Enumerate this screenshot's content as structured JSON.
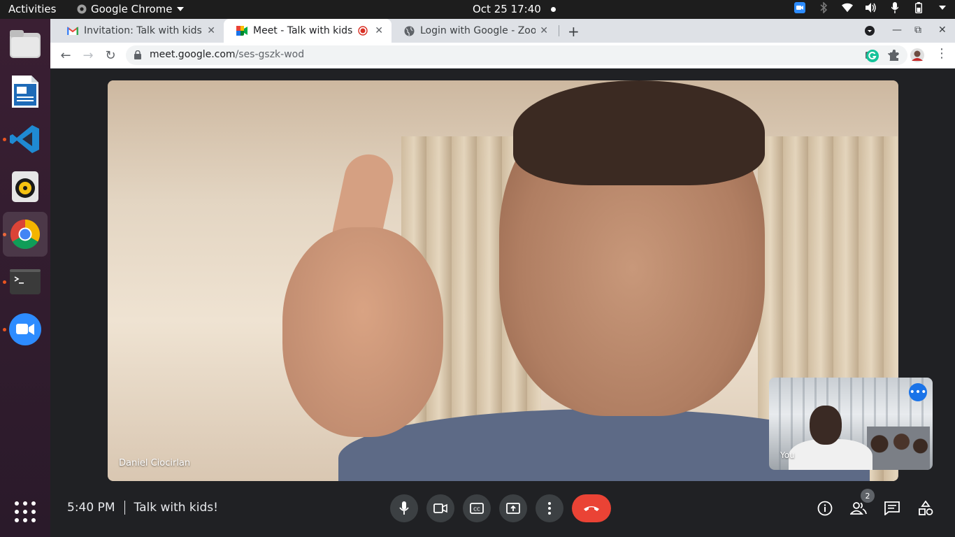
{
  "topbar": {
    "activities": "Activities",
    "app_name": "Google Chrome",
    "datetime": "Oct 25  17:40"
  },
  "dock": {
    "items": [
      "files",
      "libreoffice-writer",
      "vscode",
      "rhythmbox",
      "google-chrome",
      "terminal",
      "zoom"
    ],
    "show_apps": "show-applications"
  },
  "browser": {
    "tabs": [
      {
        "title": "Invitation: Talk with kids!",
        "icon": "gmail-icon"
      },
      {
        "title": "Meet - Talk with kids!",
        "icon": "meet-icon"
      },
      {
        "title": "Login with Google - Zoom",
        "icon": "globe-icon"
      }
    ],
    "url_host": "meet.google.com",
    "url_path": "/ses-gszk-wod"
  },
  "meet": {
    "participant_name": "Daniel Ciocirlan",
    "self_label": "You",
    "time": "5:40 PM",
    "meeting_title": "Talk with kids!",
    "participants_count": "2"
  },
  "colors": {
    "end_call": "#ea4335",
    "accent": "#1a73e8",
    "background": "#202124"
  }
}
